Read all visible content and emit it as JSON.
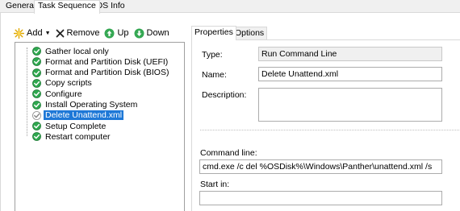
{
  "top_tabs": [
    "General",
    "Task Sequence",
    "OS Info"
  ],
  "toolbar": {
    "add": "Add",
    "remove": "Remove",
    "up": "Up",
    "down": "Down"
  },
  "tree": {
    "items": [
      {
        "label": "Gather local only"
      },
      {
        "label": "Format and Partition Disk (UEFI)"
      },
      {
        "label": "Format and Partition Disk (BIOS)"
      },
      {
        "label": "Copy scripts"
      },
      {
        "label": "Configure"
      },
      {
        "label": "Install Operating System"
      },
      {
        "label": "Delete Unattend.xml",
        "selected": true
      },
      {
        "label": "Setup Complete"
      },
      {
        "label": "Restart computer"
      }
    ]
  },
  "right_tabs": [
    "Properties",
    "Options"
  ],
  "properties": {
    "type_label": "Type:",
    "type_value": "Run Command Line",
    "name_label": "Name:",
    "name_value": "Delete Unattend.xml",
    "description_label": "Description:",
    "description_value": "",
    "command_label": "Command line:",
    "command_value": "cmd.exe /c del %OSDisk%\\Windows\\Panther\\unattend.xml /s",
    "start_in_label": "Start in:",
    "start_in_value": ""
  },
  "colors": {
    "check_green": "#2fa84f",
    "selection": "#1e78d7"
  }
}
